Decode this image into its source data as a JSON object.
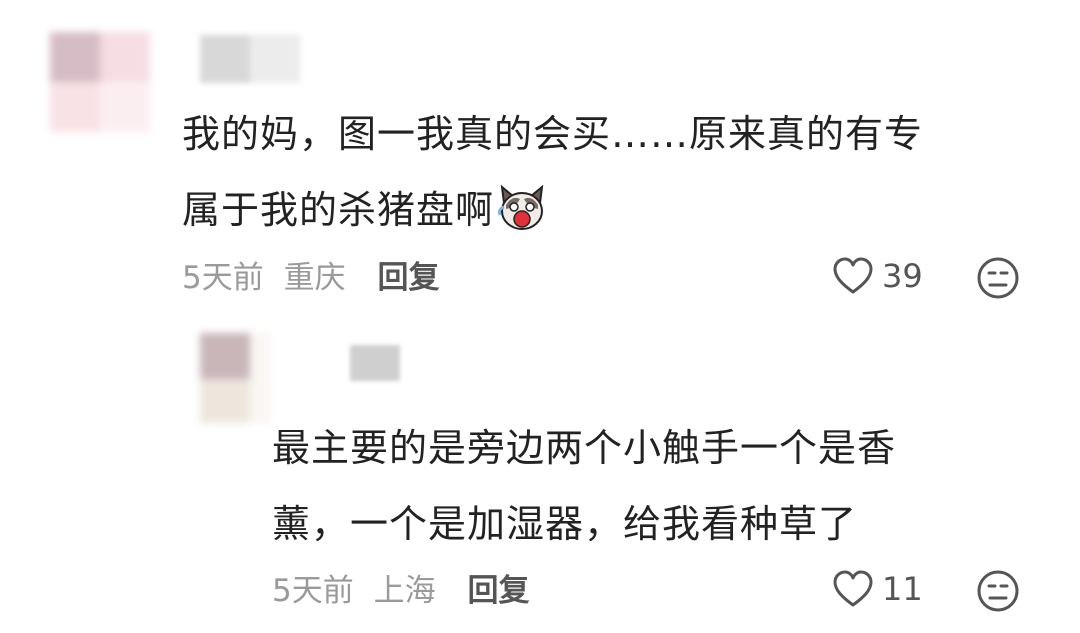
{
  "comments": [
    {
      "text_line1": "我的妈，图一我真的会买……原来真的有专",
      "text_line2": "属于我的杀猪盘啊",
      "emoji": "cat-shocked-emoji",
      "time": "5天前",
      "location": "重庆",
      "reply_label": "回复",
      "likes": "39"
    },
    {
      "text_line1": "最主要的是旁边两个小触手一个是香",
      "text_line2": "薰，一个是加湿器，给我看种草了",
      "time": "5天前",
      "location": "上海",
      "reply_label": "回复",
      "likes": "11"
    }
  ],
  "colors": {
    "text": "#222222",
    "meta": "#9a9a9a",
    "reply": "#555555",
    "icon": "#555555"
  },
  "icons": [
    "heart-outline-icon",
    "neutral-face-icon"
  ]
}
